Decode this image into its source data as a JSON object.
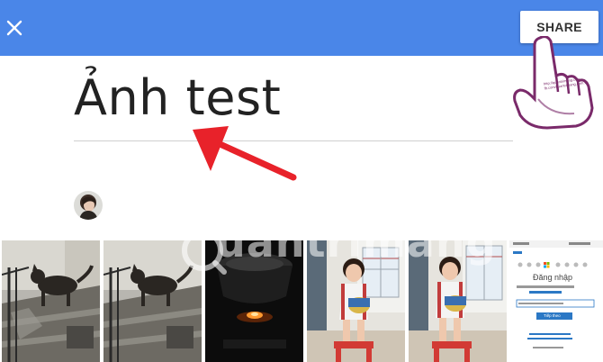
{
  "header": {
    "close_icon": "close-icon",
    "share_label": "SHARE",
    "bar_color": "#4a86e8"
  },
  "album": {
    "title": "Ảnh test"
  },
  "photos": [
    {
      "desc": "dog-on-stairs"
    },
    {
      "desc": "dog-on-stairs-2"
    },
    {
      "desc": "cooking-pot-fire"
    },
    {
      "desc": "girl-with-toy-drum"
    },
    {
      "desc": "girl-with-toy-drum-2"
    },
    {
      "desc": "microsoft-signin-screenshot"
    }
  ],
  "signin_screenshot": {
    "heading": "Đăng nhập",
    "button": "Tiếp theo",
    "brand": "Microsoft"
  },
  "overlay": {
    "watermark": "uantrimang",
    "hand_text_1": "http://quantrimang.com",
    "hand_text_2": "fb.com/quantrimang.com.vn"
  }
}
